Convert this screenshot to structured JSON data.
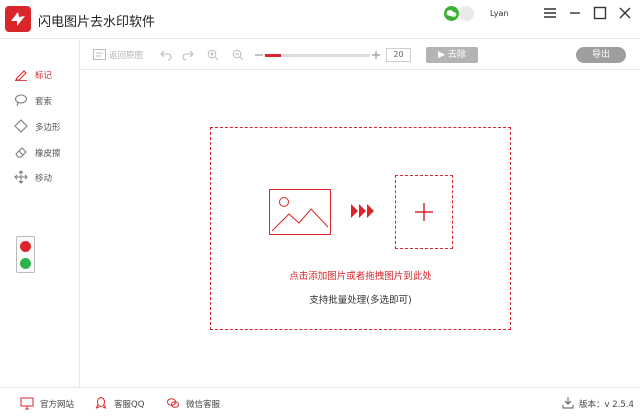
{
  "app": {
    "title": "闪电图片去水印软件",
    "user": "Lyan"
  },
  "toolbar": {
    "restore_label": "返回原图",
    "zoom_value": "20",
    "zoom_level": 0.15,
    "remove_label": "▶ 去除",
    "export_label": "导出"
  },
  "sidebar": {
    "tools": [
      {
        "label": "标记",
        "icon": "pen-icon",
        "active": true
      },
      {
        "label": "套索",
        "icon": "lasso-icon",
        "active": false
      },
      {
        "label": "多边形",
        "icon": "polygon-icon",
        "active": false
      },
      {
        "label": "橡皮擦",
        "icon": "eraser-icon",
        "active": false
      },
      {
        "label": "移动",
        "icon": "move-icon",
        "active": false
      }
    ],
    "colors": [
      "#d9262b",
      "#2bb24c"
    ]
  },
  "main": {
    "hint_primary": "点击添加图片或者拖拽图片到此处",
    "hint_secondary": "支持批量处理(多选即可)"
  },
  "footer": {
    "links": [
      {
        "label": "官方网站",
        "icon": "monitor-icon"
      },
      {
        "label": "客服QQ",
        "icon": "qq-icon"
      },
      {
        "label": "微信客服",
        "icon": "wechat-icon"
      }
    ],
    "version_label": "版本：v 2.5.4"
  },
  "colors": {
    "accent": "#d9262b",
    "green": "#2bb24c",
    "wechat": "#3cb034"
  }
}
